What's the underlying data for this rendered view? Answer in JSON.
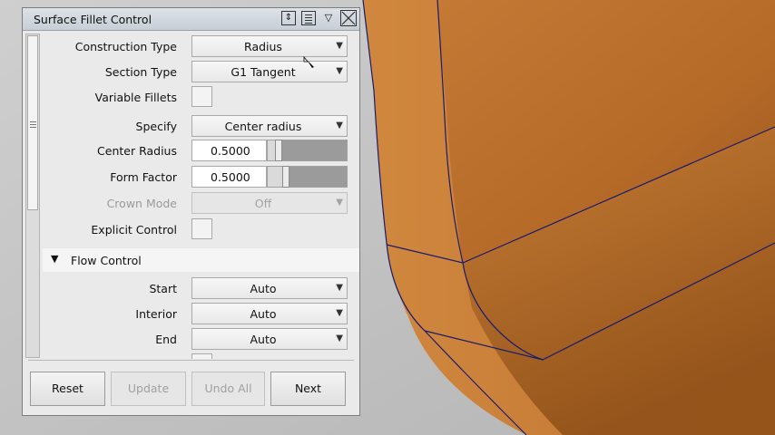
{
  "panel": {
    "title": "Surface Fillet Control",
    "titlebar_icons": [
      "resize-icon",
      "list-icon",
      "chevron-down-icon",
      "close-icon"
    ]
  },
  "fields": {
    "construction_type": {
      "label": "Construction Type",
      "value": "Radius"
    },
    "section_type": {
      "label": "Section Type",
      "value": "G1 Tangent"
    },
    "variable_fillets": {
      "label": "Variable Fillets",
      "checked": false
    },
    "specify": {
      "label": "Specify",
      "value": "Center radius"
    },
    "center_radius": {
      "label": "Center Radius",
      "value": "0.5000"
    },
    "form_factor": {
      "label": "Form Factor",
      "value": "0.5000"
    },
    "crown_mode": {
      "label": "Crown Mode",
      "value": "Off"
    },
    "explicit_control": {
      "label": "Explicit Control",
      "checked": false
    }
  },
  "flow_control": {
    "title": "Flow Control",
    "start": {
      "label": "Start",
      "value": "Auto"
    },
    "interior": {
      "label": "Interior",
      "value": "Auto"
    },
    "end": {
      "label": "End",
      "value": "Auto"
    }
  },
  "buttons": {
    "reset": "Reset",
    "update": "Update",
    "undo_all": "Undo All",
    "next": "Next"
  },
  "colors": {
    "surface": "#c87a34",
    "surface_dark": "#a8621f",
    "edge": "#1a1a6e",
    "background": "#c4c4c4"
  }
}
